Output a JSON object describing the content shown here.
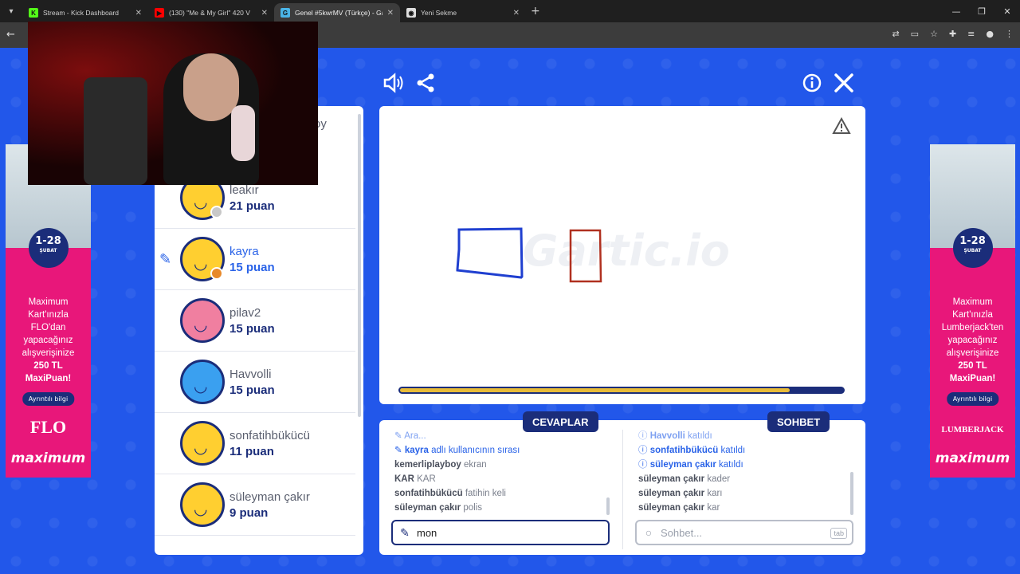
{
  "browser": {
    "tabs": [
      {
        "title": "Stream - Kick Dashboard",
        "favicon": "K",
        "color": "#53fc18"
      },
      {
        "title": "(130) \"Me & My Girl\" 420 V",
        "favicon": "▶",
        "color": "#ff0000"
      },
      {
        "title": "Genel #5kwrMV (Türkçe) - Gar",
        "favicon": "G",
        "color": "#4ab5e8",
        "active": true
      },
      {
        "title": "Yeni Sekme",
        "favicon": "◉",
        "color": "#dddddd"
      }
    ]
  },
  "game": {
    "players": [
      {
        "name": "leakır",
        "score": "21 puan",
        "dot": "#c8c8c8",
        "avatar": "yellow"
      },
      {
        "name": "kayra",
        "score": "15 puan",
        "dot": "#e8892a",
        "avatar": "yellow",
        "drawing": true
      },
      {
        "name": "pilav2",
        "score": "15 puan",
        "avatar": "pink"
      },
      {
        "name": "Havvolli",
        "score": "15 puan",
        "avatar": "blue"
      },
      {
        "name": "sonfatihbükücü",
        "score": "11 puan",
        "avatar": "yellow"
      },
      {
        "name": "süleyman çakır",
        "score": "9 puan",
        "avatar": "yellow"
      }
    ],
    "partial_player_name": "oy",
    "watermark": "Gartic.io",
    "progress": 0.88,
    "answers_label": "CEVAPLAR",
    "chat_label": "SOHBET",
    "answers": [
      {
        "type": "sys",
        "text": "Ara...",
        "faded": true
      },
      {
        "type": "sys",
        "user": "kayra",
        "text": "adlı kullanıcının sırası"
      },
      {
        "type": "msg",
        "user": "kemerliplayboy",
        "text": "ekran"
      },
      {
        "type": "msg",
        "user": "KAR",
        "text": "KAR"
      },
      {
        "type": "msg",
        "user": "sonfatihbükücü",
        "text": "fatihin keli"
      },
      {
        "type": "msg",
        "user": "süleyman çakır",
        "text": "polis"
      }
    ],
    "chat": [
      {
        "type": "sys",
        "user": "Havvolli",
        "text": "katıldı",
        "faded": true
      },
      {
        "type": "sys",
        "user": "sonfatihbükücü",
        "text": "katıldı"
      },
      {
        "type": "sys",
        "user": "süleyman çakır",
        "text": "katıldı"
      },
      {
        "type": "msg",
        "user": "süleyman çakır",
        "text": "kader"
      },
      {
        "type": "msg",
        "user": "süleyman çakır",
        "text": "karı"
      },
      {
        "type": "msg",
        "user": "süleyman çakır",
        "text": "kar"
      }
    ],
    "answer_input_value": "mon",
    "chat_placeholder": "Sohbet...",
    "tab_key": "tab"
  },
  "ads": {
    "left": {
      "badge": "1-28",
      "badge_sub": "ŞUBAT",
      "lines": [
        "Maximum",
        "Kart'ınızla",
        "FLO'dan",
        "yapacağınız",
        "alışverişinize"
      ],
      "highlight": [
        "250 TL",
        "MaxiPuan!"
      ],
      "button": "Ayrıntılı bilgi",
      "brand": "FLO",
      "maxi": "maximum"
    },
    "right": {
      "badge": "1-28",
      "badge_sub": "ŞUBAT",
      "lines": [
        "Maximum",
        "Kart'ınızla",
        "Lumberjack'ten",
        "yapacağınız",
        "alışverişinize"
      ],
      "highlight": [
        "250 TL MaxiPuan!"
      ],
      "button": "Ayrıntılı bilgi",
      "brand": "LUMBERJACK",
      "maxi": "maximum"
    }
  }
}
